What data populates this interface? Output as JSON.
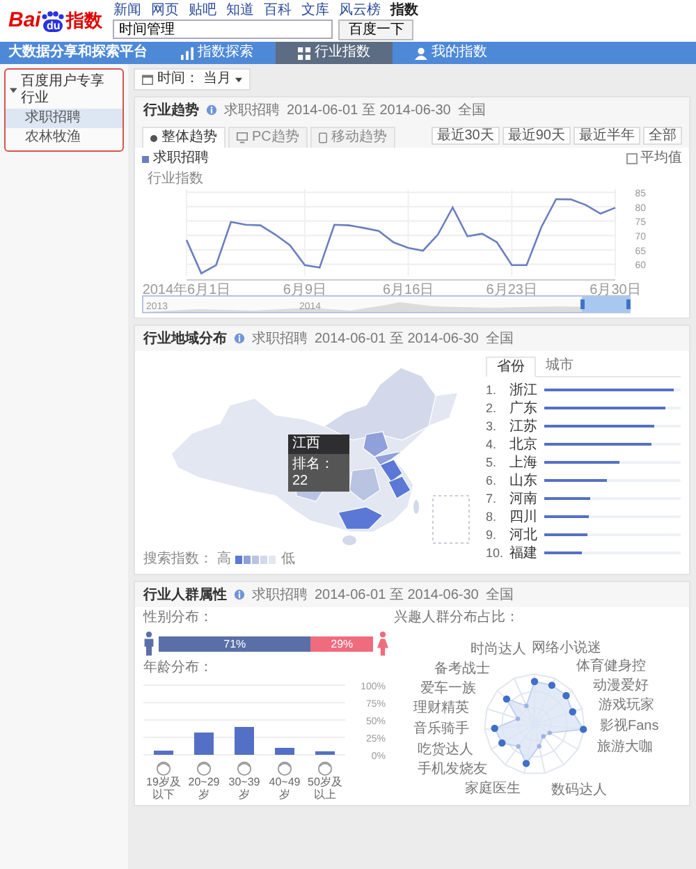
{
  "header": {
    "logo": {
      "left": "Bai",
      "badge": "du",
      "right": "指数"
    },
    "links": [
      {
        "label": "新闻",
        "selected": false
      },
      {
        "label": "网页",
        "selected": false
      },
      {
        "label": "贴吧",
        "selected": false
      },
      {
        "label": "知道",
        "selected": false
      },
      {
        "label": "百科",
        "selected": false
      },
      {
        "label": "文库",
        "selected": false
      },
      {
        "label": "风云榜",
        "selected": false
      },
      {
        "label": "指数",
        "selected": true
      }
    ],
    "search": {
      "value": "时间管理"
    },
    "search_button": "百度一下"
  },
  "nav": {
    "brand": "大数据分享和探索平台",
    "items": [
      {
        "label": "指数探索",
        "kind": "chart",
        "selected": false
      },
      {
        "label": "行业指数",
        "kind": "grid",
        "selected": true
      },
      {
        "label": "我的指数",
        "kind": "person",
        "selected": false
      }
    ]
  },
  "sidebar": {
    "items": [
      {
        "label": "百度用户专享行业",
        "expanded": true,
        "children": [
          {
            "label": "求职招聘",
            "selected": true
          },
          {
            "label": "农林牧渔",
            "selected": false
          }
        ]
      }
    ]
  },
  "time_filter": {
    "label": "时间：",
    "value": "当月"
  },
  "trend": {
    "title": "行业趋势",
    "meta": [
      "求职招聘",
      "2014-06-01 至 2014-06-30",
      "全国"
    ],
    "tabs": [
      {
        "label": "整体趋势",
        "kind": "dot",
        "selected": true
      },
      {
        "label": "PC趋势",
        "kind": "monitor",
        "selected": false
      },
      {
        "label": "移动趋势",
        "kind": "phone",
        "selected": false
      }
    ],
    "ranges": [
      "最近30天",
      "最近90天",
      "最近半年",
      "全部"
    ],
    "average": {
      "label": "平均值",
      "checked": false
    },
    "chart_data": {
      "type": "line",
      "ylabel": "行业指数",
      "categories": [
        "2014年6月1日",
        null,
        null,
        null,
        null,
        null,
        null,
        null,
        "6月9日",
        null,
        null,
        null,
        null,
        null,
        null,
        "6月16日",
        null,
        null,
        null,
        null,
        null,
        null,
        "6月23日",
        null,
        null,
        null,
        null,
        null,
        null,
        "6月30日"
      ],
      "yticks": [
        60,
        65,
        70,
        75,
        80,
        85
      ],
      "ylim": [
        56,
        86
      ],
      "grid": true,
      "series": [
        {
          "name": "求职招聘",
          "color": "#6a7fbf",
          "values": [
            68.4,
            56.8,
            59.7,
            74.7,
            73.7,
            73.5,
            70.3,
            66.6,
            59.7,
            58.8,
            73.7,
            73.5,
            72.6,
            71.6,
            67.6,
            65.7,
            64.7,
            70.3,
            79.7,
            69.7,
            70.6,
            67.6,
            59.7,
            59.7,
            72.9,
            82.6,
            82.5,
            80.6,
            77.6,
            79.6
          ]
        }
      ]
    },
    "navigator_labels": [
      "2013",
      "2014"
    ]
  },
  "region": {
    "title": "行业地域分布",
    "meta": [
      "求职招聘",
      "2014-06-01 至 2014-06-30",
      "全国"
    ],
    "tooltip": {
      "region": "江西",
      "rank": "排名：22"
    },
    "legend": {
      "label": "搜索指数：",
      "high": "高",
      "low": "低"
    },
    "tabs": [
      {
        "label": "省份",
        "selected": true
      },
      {
        "label": "城市",
        "selected": false
      }
    ],
    "ranking": [
      {
        "rank": "1.",
        "name": "浙江",
        "level": 0.95
      },
      {
        "rank": "2.",
        "name": "广东",
        "level": 0.89
      },
      {
        "rank": "3.",
        "name": "江苏",
        "level": 0.81
      },
      {
        "rank": "4.",
        "name": "北京",
        "level": 0.79
      },
      {
        "rank": "5.",
        "name": "上海",
        "level": 0.55
      },
      {
        "rank": "6.",
        "name": "山东",
        "level": 0.46
      },
      {
        "rank": "7.",
        "name": "河南",
        "level": 0.34
      },
      {
        "rank": "8.",
        "name": "四川",
        "level": 0.33
      },
      {
        "rank": "9.",
        "name": "河北",
        "level": 0.32
      },
      {
        "rank": "10.",
        "name": "福建",
        "level": 0.28
      }
    ]
  },
  "crowd": {
    "title": "行业人群属性",
    "meta": [
      "求职招聘",
      "2014-06-01 至 2014-06-30",
      "全国"
    ],
    "gender": {
      "title": "性别分布：",
      "male": "71%",
      "female": "29%",
      "level": 0.71
    },
    "age": {
      "title": "年龄分布：",
      "chart_data": {
        "type": "bar",
        "categories": [
          "19岁及以下",
          "20~29岁",
          "30~39岁",
          "40~49岁",
          "50岁及以上"
        ],
        "values": [
          6,
          32,
          40,
          10,
          5
        ],
        "ylim": [
          0,
          100
        ],
        "grid": true,
        "yticks": [
          {
            "value": 0,
            "label": "0%"
          },
          {
            "value": 25,
            "label": "25%"
          },
          {
            "value": 50,
            "label": "50%"
          },
          {
            "value": 75,
            "label": "75%"
          },
          {
            "value": 100,
            "label": "100%"
          }
        ]
      }
    },
    "interests": {
      "title": "兴趣人群分布占比：",
      "labels": [
        "网络小说迷",
        "时尚达人",
        "体育健身控",
        "备考战士",
        "动漫爱好",
        "爱车一族",
        "游戏玩家",
        "理财精英",
        "影视Fans",
        "音乐骑手",
        "旅游大咖",
        "吃货达人",
        "手机发烧友",
        "家庭医生",
        "数码达人"
      ]
    }
  }
}
